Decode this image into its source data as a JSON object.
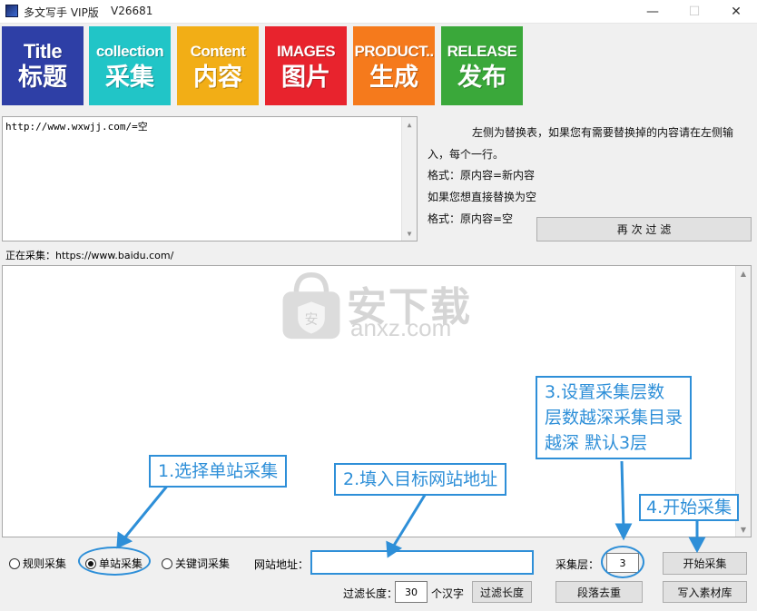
{
  "window": {
    "title": "多文写手 VIP版",
    "version": "V26681",
    "controls": [
      "—",
      "☐",
      "✕"
    ]
  },
  "toolbar": {
    "tiles": [
      {
        "en": "Title",
        "cn": "标题",
        "color": "#2e3fa6"
      },
      {
        "en": "collection",
        "cn": "采集",
        "color": "#21c5c7"
      },
      {
        "en": "Content",
        "cn": "内容",
        "color": "#f2ae16"
      },
      {
        "en": "IMAGES",
        "cn": "图片",
        "color": "#e8232d"
      },
      {
        "en": "PRODUCT..",
        "cn": "生成",
        "color": "#f57a1c"
      },
      {
        "en": "RELEASE",
        "cn": "发布",
        "color": "#3aa83a"
      }
    ]
  },
  "replace_box": {
    "value": "http://www.wxwjj.com/=空"
  },
  "hints": {
    "line1": "左侧为替换表，如果您有需要替换掉的内容请在左侧输",
    "line2": "入，每个一行。",
    "line3": "格式：原内容=新内容",
    "line4": "如果您想直接替换为空",
    "line5": "格式：原内容=空"
  },
  "refilter_button": "再 次 过 滤",
  "status": "正在采集：https://www.baidu.com/",
  "watermark": {
    "title": "安下载",
    "sub": "anxz.com"
  },
  "modes": {
    "rule": "规则采集",
    "single": "单站采集",
    "keyword": "关键词采集",
    "selected": "single"
  },
  "site_url": {
    "label": "网站地址：",
    "value": ""
  },
  "depth": {
    "label": "采集层：",
    "value": "3"
  },
  "start_button": "开始采集",
  "filter_length": {
    "label": "过滤长度：",
    "value": "30",
    "unit": "个汉字",
    "button": "过滤长度"
  },
  "dedupe_button": "段落去重",
  "write_button": "写入素材库",
  "callouts": {
    "c1": "1.选择单站采集",
    "c2": "2.填入目标网站地址",
    "c3_line1": "3.设置采集层数",
    "c3_line2": "层数越深采集目录",
    "c3_line3": "越深 默认3层",
    "c4": "4.开始采集"
  },
  "accent": "#2e8fd8"
}
